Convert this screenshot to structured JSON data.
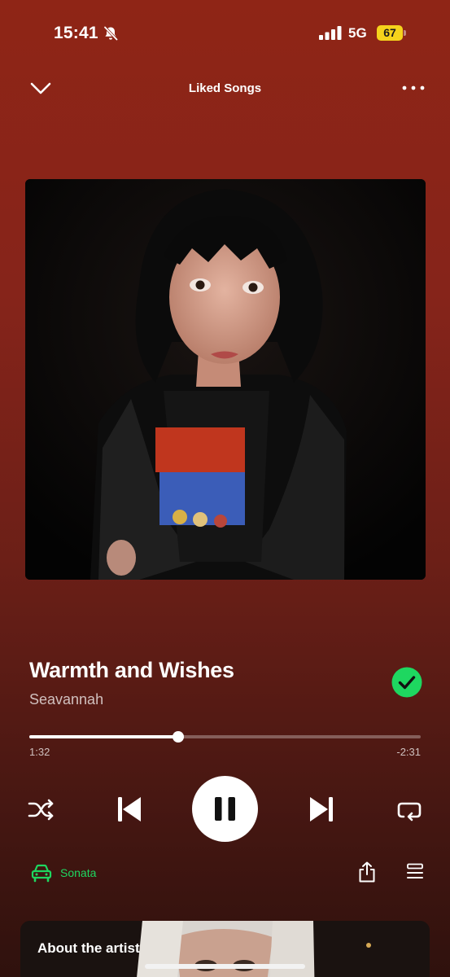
{
  "status_bar": {
    "time": "15:41",
    "network": "5G",
    "battery": "67",
    "battery_color": "#f5d31c",
    "icons": [
      "bell-slash-icon",
      "signal-bars-icon"
    ]
  },
  "header": {
    "context_title": "Liked Songs",
    "left_icon": "chevron-down-icon",
    "right_icon": "more-dots-icon"
  },
  "track": {
    "title": "Warmth and Wishes",
    "artist": "Seavannah",
    "liked": true,
    "liked_color": "#1ed760"
  },
  "playback": {
    "elapsed": "1:32",
    "remaining": "-2:31",
    "progress_fraction": 0.38,
    "state": "playing"
  },
  "controls": {
    "icons": [
      "shuffle-icon",
      "previous-icon",
      "pause-icon",
      "next-icon",
      "repeat-icon"
    ]
  },
  "device": {
    "label": "Sonata",
    "icon": "car-icon",
    "color": "#1ed760"
  },
  "actions": {
    "icons": [
      "share-icon",
      "queue-icon"
    ]
  },
  "about_artist": {
    "title": "About the artist"
  }
}
